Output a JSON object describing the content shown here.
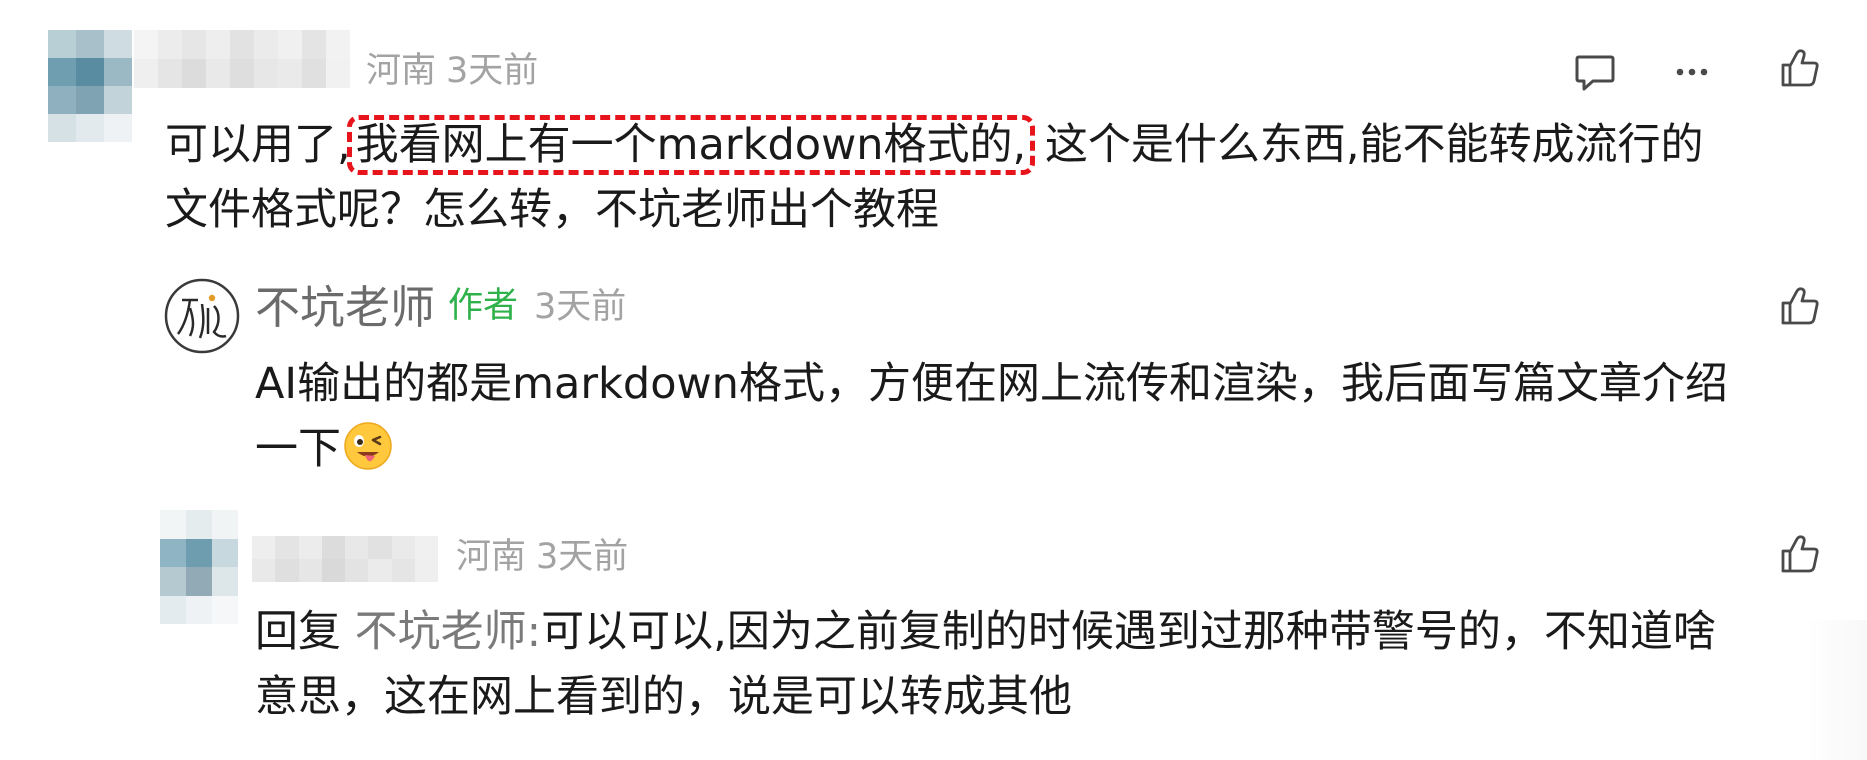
{
  "comment": {
    "location": "河南",
    "time": "3天前",
    "text_before_highlight": "可以用了,",
    "text_highlight": "我看网上有一个markdown格式的,",
    "text_after_highlight": "这个是什么东西,能不能转成流行的",
    "text_line2": "文件格式呢？怎么转，不坑老师出个教程"
  },
  "author_reply": {
    "name": "不坑老师",
    "badge": "作者",
    "time": "3天前",
    "line1": "AI输出的都是markdown格式，方便在网上流传和渲染，我后面写篇文章介绍",
    "line2": "一下"
  },
  "user_reply": {
    "location": "河南",
    "time": "3天前",
    "reply_prefix": "回复",
    "reply_to": "不坑老师:",
    "line1_rest": "可以可以,因为之前复制的时候遇到过那种带警号的，不知道啥",
    "line2": "意思，这在网上看到的，说是可以转成其他"
  },
  "icons": {
    "comment": "comment-bubble-icon",
    "more": "more-dots-icon",
    "like": "thumbs-up-icon",
    "emoji": "winking-tongue-emoji"
  },
  "colors": {
    "highlight_border": "#e8141c",
    "author_badge": "#2fb24b",
    "meta_text": "#a3a3a3"
  }
}
